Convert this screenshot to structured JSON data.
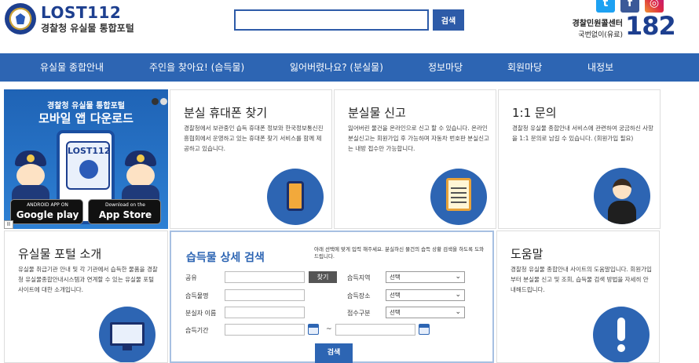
{
  "header": {
    "brand": "LOST112",
    "brand_sub": "경찰청 유실물 통합포털",
    "search_button": "검색",
    "call_center_label": "경찰민원콜센터",
    "call_center_sub": "국번없이(유료)",
    "call_center_number": "182"
  },
  "nav": {
    "items": [
      {
        "label": "유실물 종합안내"
      },
      {
        "label": "주인을 찾아요! (습득물)"
      },
      {
        "label": "잃어버렸나요? (분실물)"
      },
      {
        "label": "정보마당"
      },
      {
        "label": "회원마당"
      },
      {
        "label": "내정보"
      }
    ]
  },
  "banner": {
    "subtitle": "경찰청 유실물 통합포털",
    "title": "모바일 앱 다운로드",
    "app_label": "LOST112",
    "google_small": "ANDROID APP ON",
    "google_big": "Google play",
    "apple_small": "Download on the",
    "apple_big": "App Store",
    "pause": "II"
  },
  "cards": {
    "phone": {
      "title": "분실 휴대폰 찾기",
      "desc": "경찰청에서 보관중인 습득 휴대폰 정보와 한국정보통신진흥협회에서 운영하고 있는 휴대폰 찾기 서비스를 함께 제공하고 있습니다."
    },
    "report": {
      "title": "분실물 신고",
      "desc": "잃어버린 물건을 온라인으로 신고 할 수 있습니다. 온라인 분실신고는 회원가입 후 가능하며 자동차 번호판 분실신고는 내방 접수만 가능합니다."
    },
    "qna": {
      "title": "1:1 문의",
      "desc": "경찰청 유실물 종합안내 서비스에 관련하여 궁금하신 사항을 1:1 문의로 남길 수 있습니다. (회원가입 필요)"
    },
    "intro": {
      "title": "유실물 포털 소개",
      "desc": "유실물 취급기관 안내 및 각 기관에서 습득한 물품을 경찰청 유실물종합안내시스템과 연계할 수 있는 유실물 포털 사이트에 대한 소개입니다."
    },
    "help": {
      "title": "도움말",
      "desc": "경찰청 유실물 종합안내 사이트의 도움말입니다. 회원가입부터 분실물 신고 및 조회, 습득물 검색 방법을 자세히 안내해드립니다."
    }
  },
  "detail_search": {
    "title": "습득물 상세 검색",
    "note": "아래 선택에 맞게 입력 해주세요. 분실하신 물건의 습득 상황 검색을 하도록 도와드립니다.",
    "fields": {
      "category_label": "공유",
      "category_button": "찾기",
      "region_label": "습득지역",
      "region_value": "선택",
      "item_name_label": "습득물명",
      "place_label": "습득장소",
      "place_value": "선택",
      "loser_name_label": "분실자 이름",
      "office_label": "접수구분",
      "office_value": "선택",
      "period_label": "습득기간",
      "period_sep": "~"
    },
    "search_button": "검색"
  },
  "colors": {
    "primary": "#2d65b3",
    "brand": "#1d3f8f"
  }
}
